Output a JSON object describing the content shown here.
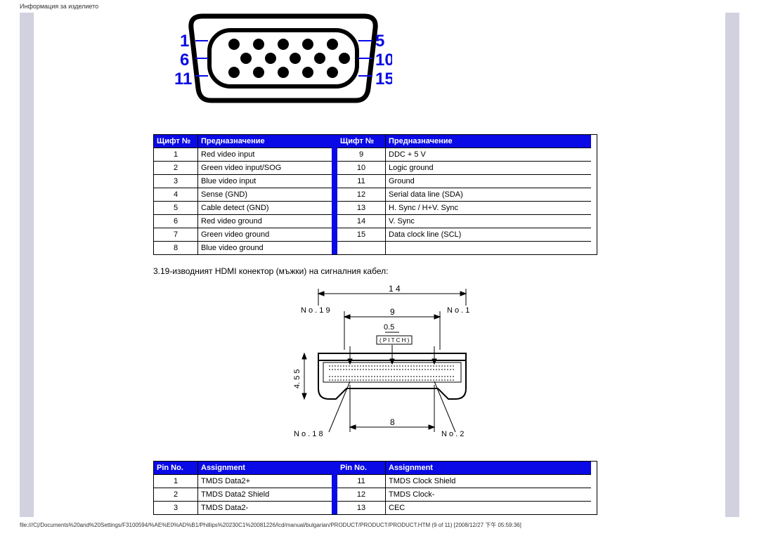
{
  "header": "Информация за изделието",
  "vga_labels": {
    "l1": "1",
    "l2": "6",
    "l3": "11",
    "r1": "5",
    "r2": "10",
    "r3": "15"
  },
  "pin_table1": {
    "h1": "Щифт №",
    "h2": "Предназначение",
    "h3": "Щифт №",
    "h4": "Предназначение",
    "left": [
      {
        "n": "1",
        "a": "Red video input"
      },
      {
        "n": "2",
        "a": "Green video input/SOG"
      },
      {
        "n": "3",
        "a": "Blue video input"
      },
      {
        "n": "4",
        "a": "Sense (GND)"
      },
      {
        "n": "5",
        "a": "Cable detect (GND)"
      },
      {
        "n": "6",
        "a": "Red video ground"
      },
      {
        "n": "7",
        "a": "Green video ground"
      },
      {
        "n": "8",
        "a": "Blue video ground"
      }
    ],
    "right": [
      {
        "n": "9",
        "a": "DDC + 5 V"
      },
      {
        "n": "10",
        "a": "Logic ground"
      },
      {
        "n": "11",
        "a": "Ground"
      },
      {
        "n": "12",
        "a": "Serial data line (SDA)"
      },
      {
        "n": "13",
        "a": "H. Sync / H+V. Sync"
      },
      {
        "n": "14",
        "a": "V. Sync"
      },
      {
        "n": "15",
        "a": "Data clock line (SCL)"
      }
    ]
  },
  "hdmi_intro": "3.19-изводният HDMI конектор (мъжки) на сигналния кабел:",
  "hdmi_dims": {
    "top": "1 4",
    "w": "9",
    "h": "0.5",
    "pitch": "( P I T C H )",
    "left": "4. 5 5",
    "bot": "8",
    "n19": "N o . 1 9",
    "n1": "N o . 1",
    "n18": "N o . 1 8",
    "n2": "N o . 2"
  },
  "pin_table2": {
    "h1": "Pin No.",
    "h2": "Assignment",
    "h3": "Pin No.",
    "h4": "Assignment",
    "left": [
      {
        "n": "1",
        "a": "TMDS Data2+"
      },
      {
        "n": "2",
        "a": "TMDS Data2 Shield"
      },
      {
        "n": "3",
        "a": "TMDS Data2-"
      }
    ],
    "right": [
      {
        "n": "11",
        "a": "TMDS Clock Shield"
      },
      {
        "n": "12",
        "a": "TMDS Clock-"
      },
      {
        "n": "13",
        "a": "CEC"
      }
    ]
  },
  "footer": "file:///C|/Documents%20and%20Settings/F3100594/%AE%E0%AD%B1/Phillips%20230C1%20081226/lcd/manual/bulgarian/PRODUCT/PRODUCT/PRODUCT.HTM (9 of 11) [2008/12/27 下午 05:59:36]"
}
